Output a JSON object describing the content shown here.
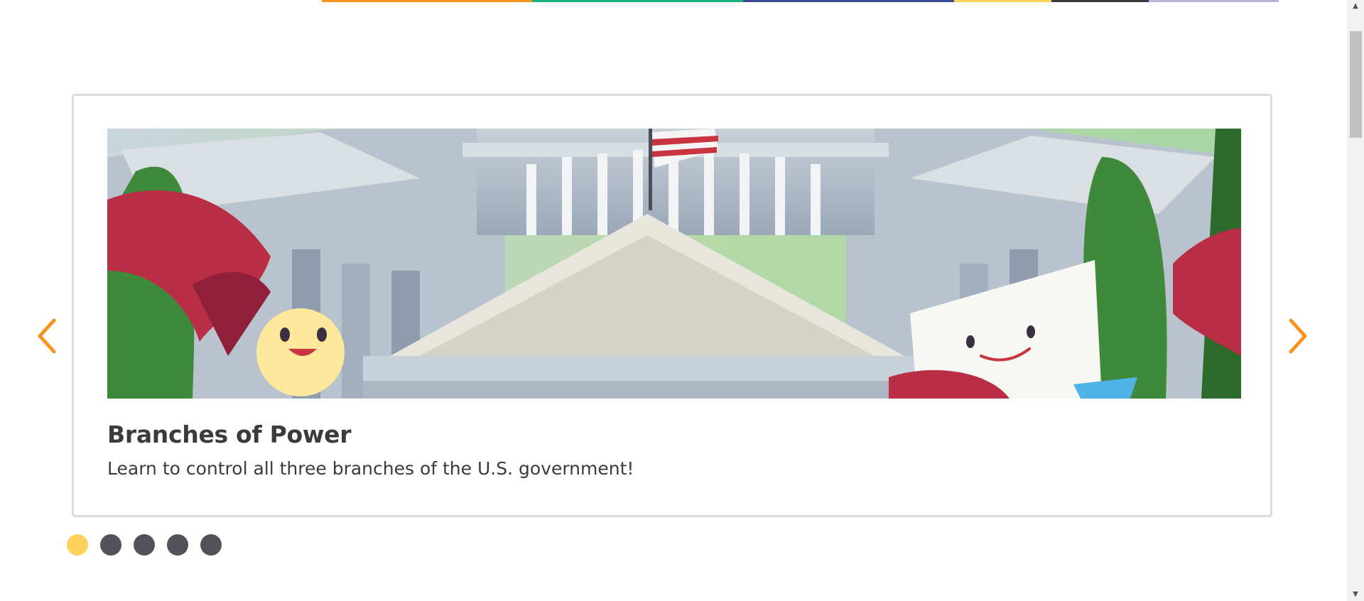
{
  "top_stripe": {
    "colors": [
      "#f7941d",
      "#17b07a",
      "#3d4999",
      "#fcd15c",
      "#3b3b3b",
      "#b9b2dc"
    ]
  },
  "carousel": {
    "slide": {
      "title": "Branches of Power",
      "description": "Learn to control all three branches of the U.S. government!",
      "image_icon": "capitol-building-illustration"
    },
    "prev_icon": "chevron-left-icon",
    "next_icon": "chevron-right-icon",
    "arrow_color": "#f7941d",
    "dot_count": 5,
    "active_dot": 1,
    "active_dot_color": "#fcd15c",
    "inactive_dot_color": "#525258"
  },
  "scrollbar": {
    "up_icon": "scroll-up-arrow-icon",
    "down_icon": "scroll-down-arrow-icon"
  }
}
